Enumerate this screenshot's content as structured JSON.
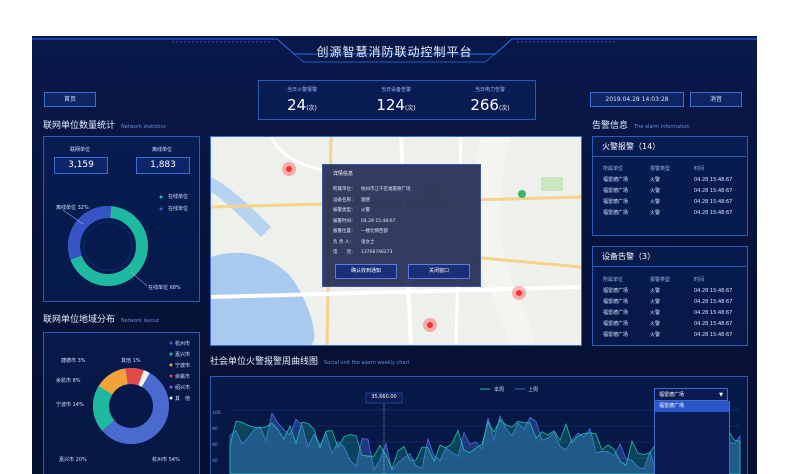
{
  "header": {
    "title": "创源智慧消防联动控制平台"
  },
  "nav": {
    "home": "首页",
    "datetime": "2019.04.28  14:03:28",
    "logout": "消音"
  },
  "kpis": [
    {
      "label": "当日火警报警",
      "value": "24",
      "unit": "(次)"
    },
    {
      "label": "当日设备告警",
      "value": "124",
      "unit": "(次)"
    },
    {
      "label": "当日电力告警",
      "value": "266",
      "unit": "(次)"
    }
  ],
  "stats": {
    "title": "联网单位数量统计",
    "subtitle": "Network statistics",
    "online_label": "联网单位",
    "online_value": "3,159",
    "offline_label": "离线单位",
    "offline_value": "1,883",
    "legend": [
      "在线单位",
      "在线单位"
    ],
    "offline_pct": "离线单位 32%",
    "online_pct": "在线单位 68%"
  },
  "dist": {
    "title": "联网单位地域分布",
    "subtitle": "Network layout",
    "legend": [
      "杭州市",
      "嘉兴市",
      "宁波市",
      "余姚市",
      "绍兴市",
      "其　他"
    ],
    "labels": [
      "捷德市 3%",
      "余杭市 8%",
      "宁波市 14%",
      "嘉兴市 20%",
      "其他 1%",
      "杭州市 54%"
    ]
  },
  "popup": {
    "title": "详情信息",
    "rows": [
      {
        "k": "所属单位：",
        "v": "杭州市江干区福雷德广场"
      },
      {
        "k": "设备名称：",
        "v": "烟感"
      },
      {
        "k": "报警类型：",
        "v": "火警"
      },
      {
        "k": "报警时间：",
        "v": "04.28   15:48:67"
      },
      {
        "k": "报警位置：",
        "v": "一楼北侧西部"
      },
      {
        "k": "负 责 人：",
        "v": "张女士"
      },
      {
        "k": "电　　话：",
        "v": "13768746273"
      }
    ],
    "confirm": "确认收到通知",
    "close": "关闭窗口"
  },
  "alarm": {
    "title": "告警信息",
    "subtitle": "The alarm information",
    "fire_title": "火警报警（14）",
    "device_title": "设备告警（3）",
    "cols": [
      "所属单位",
      "报警类型",
      "时间"
    ],
    "fire_rows": [
      [
        "福雷德广场",
        "火警",
        "04.28   15:48:67"
      ],
      [
        "福雷德广场",
        "火警",
        "04.28   15:48:67"
      ],
      [
        "福雷德广场",
        "火警",
        "04.28   15:48:67"
      ],
      [
        "福雷德广场",
        "火警",
        "04.28   15:48:67"
      ]
    ],
    "device_rows": [
      [
        "福雷德广场",
        "火警",
        "04.28   15:48:67"
      ],
      [
        "福雷德广场",
        "火警",
        "04.28   15:48:67"
      ],
      [
        "福雷德广场",
        "火警",
        "04.28   15:48:67"
      ],
      [
        "福雷德广场",
        "火警",
        "04.28   15:48:67"
      ],
      [
        "福雷德广场",
        "火警",
        "04.28   15:48:67"
      ]
    ]
  },
  "weekly": {
    "title": "社会单位火警报警周曲线图",
    "subtitle": "Social unit fire alarm weekly chart",
    "legend": [
      "本周",
      "上周"
    ],
    "tooltip": "35,660.00",
    "select_value": "福雷德广场",
    "select_option": "福雷德广场",
    "yticks": [
      "100",
      "80",
      "60",
      "40",
      "20"
    ]
  },
  "colors": {
    "accent": "#1fc3a4",
    "primary": "#3d5fc8",
    "alert": "#ff3030"
  }
}
